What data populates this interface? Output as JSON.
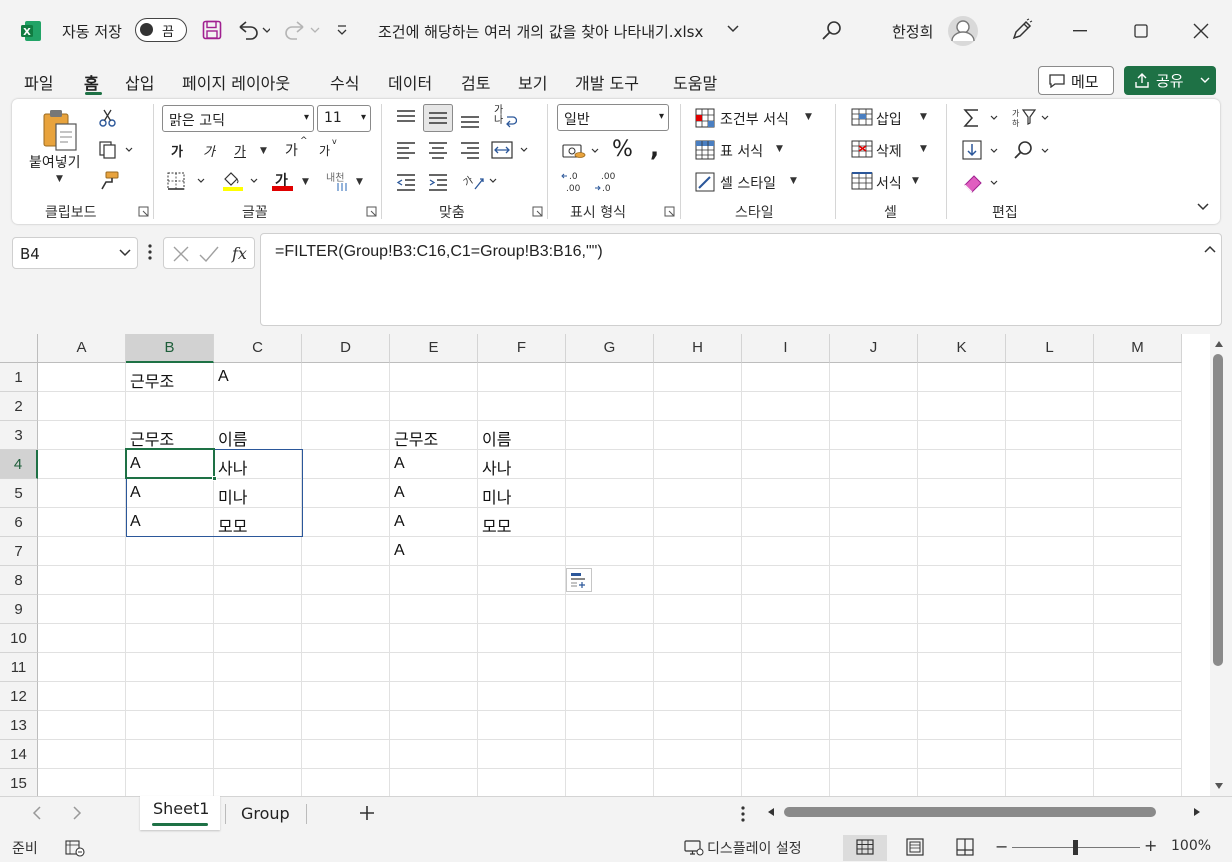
{
  "titlebar": {
    "autosave_label": "자동 저장",
    "autosave_state": "끔",
    "filename": "조건에 해당하는 여러 개의 값을 찾아 나타내기.xlsx",
    "user_name": "한정희",
    "colors": {
      "excel_green": "#1e7145",
      "save_purple": "#a02090"
    }
  },
  "menu": {
    "tabs": [
      "파일",
      "홈",
      "삽입",
      "페이지 레이아웃",
      "수식",
      "데이터",
      "검토",
      "보기",
      "개발 도구",
      "도움말"
    ],
    "active_tab": "홈",
    "memo_label": "메모",
    "share_label": "공유"
  },
  "ribbon": {
    "clipboard": {
      "paste_label": "붙여넣기",
      "group_label": "클립보드"
    },
    "font": {
      "font_name": "맑은 고딕",
      "font_size": "11",
      "bold": "가",
      "italic": "가",
      "underline": "가",
      "grow": "가",
      "shrink": "가",
      "font_color_glyph": "가",
      "phonetic": "내천",
      "group_label": "글꼴"
    },
    "alignment": {
      "wrap_glyph": "가나",
      "group_label": "맞춤"
    },
    "number": {
      "format": "일반",
      "group_label": "표시 형식"
    },
    "styles": {
      "conditional": "조건부 서식",
      "table": "표 서식",
      "cell_style": "셀 스타일",
      "group_label": "스타일"
    },
    "cells": {
      "insert": "삽입",
      "delete": "삭제",
      "format": "서식",
      "group_label": "셀"
    },
    "editing": {
      "group_label": "편집"
    }
  },
  "formula_bar": {
    "name_box": "B4",
    "formula": "=FILTER(Group!B3:C16,C1=Group!B3:B16,\"\")"
  },
  "grid": {
    "columns": [
      "A",
      "B",
      "C",
      "D",
      "E",
      "F",
      "G",
      "H",
      "I",
      "J",
      "K",
      "L",
      "M"
    ],
    "rows": [
      "1",
      "2",
      "3",
      "4",
      "5",
      "6",
      "7",
      "8",
      "9",
      "10",
      "11",
      "12",
      "13",
      "14",
      "15"
    ],
    "selected_column": "B",
    "selected_row": "4",
    "cells": {
      "B1": "근무조",
      "C1": "A",
      "B3": "근무조",
      "C3": "이름",
      "E3": "근무조",
      "F3": "이름",
      "B4": "A",
      "C4": "사나",
      "E4": "A",
      "F4": "사나",
      "B5": "A",
      "C5": "미나",
      "E5": "A",
      "F5": "미나",
      "B6": "A",
      "C6": "모모",
      "E6": "A",
      "F6": "모모",
      "E7": "A"
    }
  },
  "sheets": {
    "tabs": [
      "Sheet1",
      "Group"
    ],
    "active": "Sheet1"
  },
  "status": {
    "ready": "준비",
    "display_settings": "디스플레이 설정",
    "zoom": "100%",
    "zoom_minus": "−",
    "zoom_plus": "+"
  }
}
